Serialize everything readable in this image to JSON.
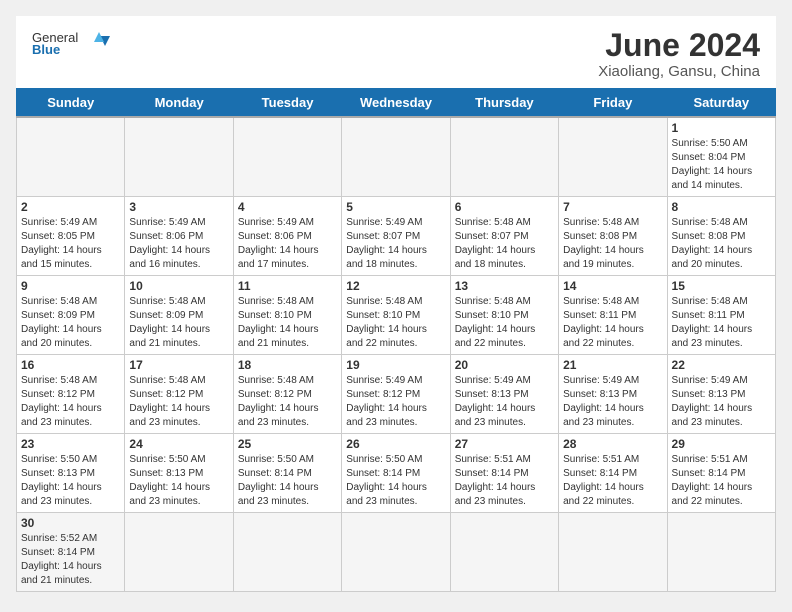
{
  "header": {
    "logo_general": "General",
    "logo_blue": "Blue",
    "title": "June 2024",
    "subtitle": "Xiaoliang, Gansu, China"
  },
  "days": [
    "Sunday",
    "Monday",
    "Tuesday",
    "Wednesday",
    "Thursday",
    "Friday",
    "Saturday"
  ],
  "weeks": [
    [
      {
        "date": "",
        "info": ""
      },
      {
        "date": "",
        "info": ""
      },
      {
        "date": "",
        "info": ""
      },
      {
        "date": "",
        "info": ""
      },
      {
        "date": "",
        "info": ""
      },
      {
        "date": "",
        "info": ""
      },
      {
        "date": "1",
        "info": "Sunrise: 5:50 AM\nSunset: 8:04 PM\nDaylight: 14 hours and 14 minutes."
      }
    ],
    [
      {
        "date": "2",
        "info": "Sunrise: 5:49 AM\nSunset: 8:05 PM\nDaylight: 14 hours and 15 minutes."
      },
      {
        "date": "3",
        "info": "Sunrise: 5:49 AM\nSunset: 8:06 PM\nDaylight: 14 hours and 16 minutes."
      },
      {
        "date": "4",
        "info": "Sunrise: 5:49 AM\nSunset: 8:06 PM\nDaylight: 14 hours and 17 minutes."
      },
      {
        "date": "5",
        "info": "Sunrise: 5:49 AM\nSunset: 8:07 PM\nDaylight: 14 hours and 18 minutes."
      },
      {
        "date": "6",
        "info": "Sunrise: 5:48 AM\nSunset: 8:07 PM\nDaylight: 14 hours and 18 minutes."
      },
      {
        "date": "7",
        "info": "Sunrise: 5:48 AM\nSunset: 8:08 PM\nDaylight: 14 hours and 19 minutes."
      },
      {
        "date": "8",
        "info": "Sunrise: 5:48 AM\nSunset: 8:08 PM\nDaylight: 14 hours and 20 minutes."
      }
    ],
    [
      {
        "date": "9",
        "info": "Sunrise: 5:48 AM\nSunset: 8:09 PM\nDaylight: 14 hours and 20 minutes."
      },
      {
        "date": "10",
        "info": "Sunrise: 5:48 AM\nSunset: 8:09 PM\nDaylight: 14 hours and 21 minutes."
      },
      {
        "date": "11",
        "info": "Sunrise: 5:48 AM\nSunset: 8:10 PM\nDaylight: 14 hours and 21 minutes."
      },
      {
        "date": "12",
        "info": "Sunrise: 5:48 AM\nSunset: 8:10 PM\nDaylight: 14 hours and 22 minutes."
      },
      {
        "date": "13",
        "info": "Sunrise: 5:48 AM\nSunset: 8:10 PM\nDaylight: 14 hours and 22 minutes."
      },
      {
        "date": "14",
        "info": "Sunrise: 5:48 AM\nSunset: 8:11 PM\nDaylight: 14 hours and 22 minutes."
      },
      {
        "date": "15",
        "info": "Sunrise: 5:48 AM\nSunset: 8:11 PM\nDaylight: 14 hours and 23 minutes."
      }
    ],
    [
      {
        "date": "16",
        "info": "Sunrise: 5:48 AM\nSunset: 8:12 PM\nDaylight: 14 hours and 23 minutes."
      },
      {
        "date": "17",
        "info": "Sunrise: 5:48 AM\nSunset: 8:12 PM\nDaylight: 14 hours and 23 minutes."
      },
      {
        "date": "18",
        "info": "Sunrise: 5:48 AM\nSunset: 8:12 PM\nDaylight: 14 hours and 23 minutes."
      },
      {
        "date": "19",
        "info": "Sunrise: 5:49 AM\nSunset: 8:12 PM\nDaylight: 14 hours and 23 minutes."
      },
      {
        "date": "20",
        "info": "Sunrise: 5:49 AM\nSunset: 8:13 PM\nDaylight: 14 hours and 23 minutes."
      },
      {
        "date": "21",
        "info": "Sunrise: 5:49 AM\nSunset: 8:13 PM\nDaylight: 14 hours and 23 minutes."
      },
      {
        "date": "22",
        "info": "Sunrise: 5:49 AM\nSunset: 8:13 PM\nDaylight: 14 hours and 23 minutes."
      }
    ],
    [
      {
        "date": "23",
        "info": "Sunrise: 5:50 AM\nSunset: 8:13 PM\nDaylight: 14 hours and 23 minutes."
      },
      {
        "date": "24",
        "info": "Sunrise: 5:50 AM\nSunset: 8:13 PM\nDaylight: 14 hours and 23 minutes."
      },
      {
        "date": "25",
        "info": "Sunrise: 5:50 AM\nSunset: 8:14 PM\nDaylight: 14 hours and 23 minutes."
      },
      {
        "date": "26",
        "info": "Sunrise: 5:50 AM\nSunset: 8:14 PM\nDaylight: 14 hours and 23 minutes."
      },
      {
        "date": "27",
        "info": "Sunrise: 5:51 AM\nSunset: 8:14 PM\nDaylight: 14 hours and 23 minutes."
      },
      {
        "date": "28",
        "info": "Sunrise: 5:51 AM\nSunset: 8:14 PM\nDaylight: 14 hours and 22 minutes."
      },
      {
        "date": "29",
        "info": "Sunrise: 5:51 AM\nSunset: 8:14 PM\nDaylight: 14 hours and 22 minutes."
      }
    ],
    [
      {
        "date": "30",
        "info": "Sunrise: 5:52 AM\nSunset: 8:14 PM\nDaylight: 14 hours and 21 minutes."
      },
      {
        "date": "",
        "info": ""
      },
      {
        "date": "",
        "info": ""
      },
      {
        "date": "",
        "info": ""
      },
      {
        "date": "",
        "info": ""
      },
      {
        "date": "",
        "info": ""
      },
      {
        "date": "",
        "info": ""
      }
    ]
  ]
}
